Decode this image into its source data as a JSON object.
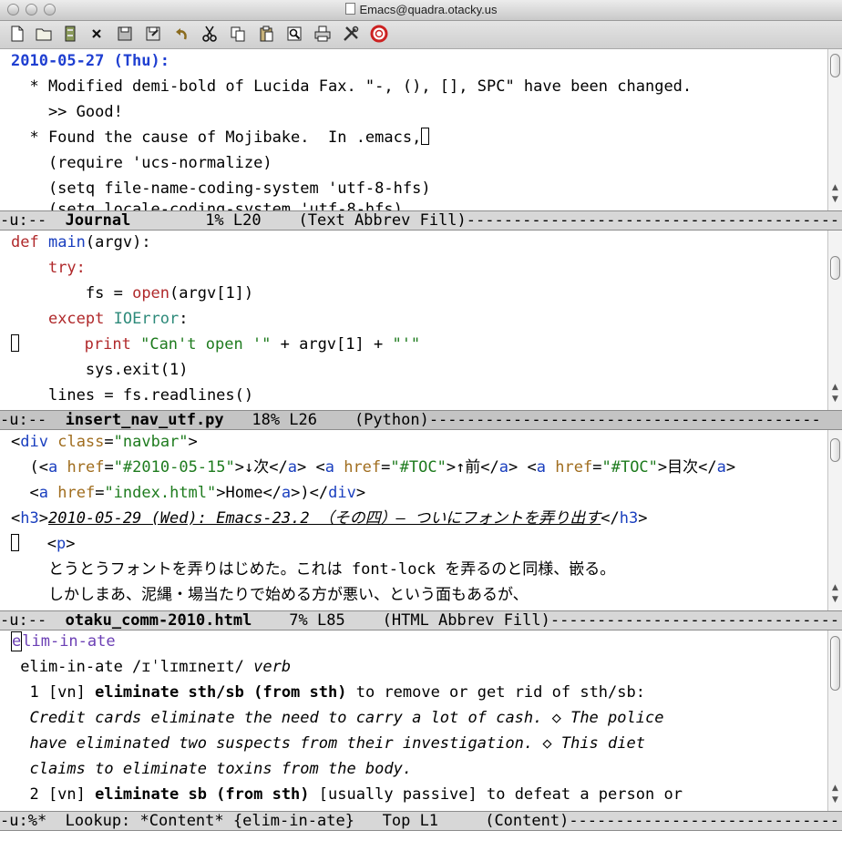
{
  "window": {
    "title": "Emacs@quadra.otacky.us"
  },
  "toolbar": {
    "icons": [
      "new-file-icon",
      "open-folder-icon",
      "dired-icon",
      "close-icon",
      "save-icon",
      "save-as-icon",
      "undo-icon",
      "cut-icon",
      "copy-icon",
      "paste-icon",
      "search-icon",
      "print-icon",
      "customize-icon",
      "help-icon"
    ]
  },
  "pane1": {
    "l1": "2010-05-27 (Thu):",
    "l2": "  * Modified demi-bold of Lucida Fax. \"-, (), [], SPC\" have been changed.",
    "l3": "    >> Good!",
    "l4": "  * Found the cause of Mojibake.  In .emacs,",
    "l5": "    (require 'ucs-normalize)",
    "l6": "    (setq file-name-coding-system 'utf-8-hfs)",
    "modeline": {
      "flags": "-u:--  ",
      "buffer": "Journal",
      "info": "        1% L20    (Text Abbrev Fill)------------------------------------------"
    }
  },
  "pane2": {
    "def": "def",
    "main": "main",
    "argv_sig": "(argv):",
    "try": "try:",
    "fs1": "fs = ",
    "open": "open",
    "fs2": "(argv[1])",
    "except": "except",
    "ioerr": "IOError",
    "colon": ":",
    "print": "print",
    "s1": "\"Can't open '\"",
    "plus1": " + argv[1] + ",
    "s2": "\"'\"",
    "exit": "sys.exit(1)",
    "lines": "lines = fs.readlines()",
    "modeline": {
      "flags": "-u:--  ",
      "buffer": "insert_nav_utf.py",
      "info": "   18% L26    (Python)------------------------------------------"
    }
  },
  "pane3": {
    "a_open": "<",
    "div": "div",
    "sp": " ",
    "class": "class",
    "eq": "=",
    "navbar": "\"navbar\"",
    "gt": ">",
    "r2pre": "(",
    "a": "a",
    "href": "href",
    "h1": "\"#2010-05-15\"",
    "t1": ">↓次</",
    "t1b": ">",
    "h2": "\"#TOC\"",
    "t2": ">↑前</",
    "h3v": "\"#TOC\"",
    "t3": ">目次</",
    "h4": "\"index.html\"",
    "t4": ">Home</",
    "t4b": ">)</",
    "close_div": ">",
    "h3tag": "h3",
    "h3text": "2010-05-29 (Wed): Emacs-23.2 （その四）― ついにフォントを弄り出す",
    "h3close": "</",
    "p": "p",
    "jp1": "とうとうフォントを弄りはじめた。これは font-lock を弄るのと同様、嵌る。",
    "jp2": "しかしまあ、泥縄・場当たりで始める方が悪い、という面もあるが、",
    "modeline": {
      "flags": "-u:--  ",
      "buffer": "otaku_comm-2010.html",
      "info": "    7% L85    (HTML Abbrev Fill)--------------------------------"
    }
  },
  "pane4": {
    "head_e": "e",
    "head_rest": "lim-in-ate",
    "pron": " elim-in-ate /ɪˈlɪmɪneɪt/ ",
    "verb": "verb",
    "n1": "  1 [vn] ",
    "def1b": "eliminate sth/sb (from sth)",
    "def1": " to remove or get rid of sth/sb:",
    "ex1": "  Credit cards eliminate the need to carry a lot of cash. ◇ The police",
    "ex2": "  have eliminated two suspects from their investigation. ◇ This diet",
    "ex3": "  claims to eliminate toxins from the body.",
    "n2": "  2 [vn] ",
    "def2b": "eliminate sb (from sth)",
    "def2": " [usually passive] to defeat a person or",
    "modeline": {
      "text": "-u:%*  Lookup: *Content* {elim-in-ate}   Top L1     (Content)------------------------------------------"
    }
  }
}
